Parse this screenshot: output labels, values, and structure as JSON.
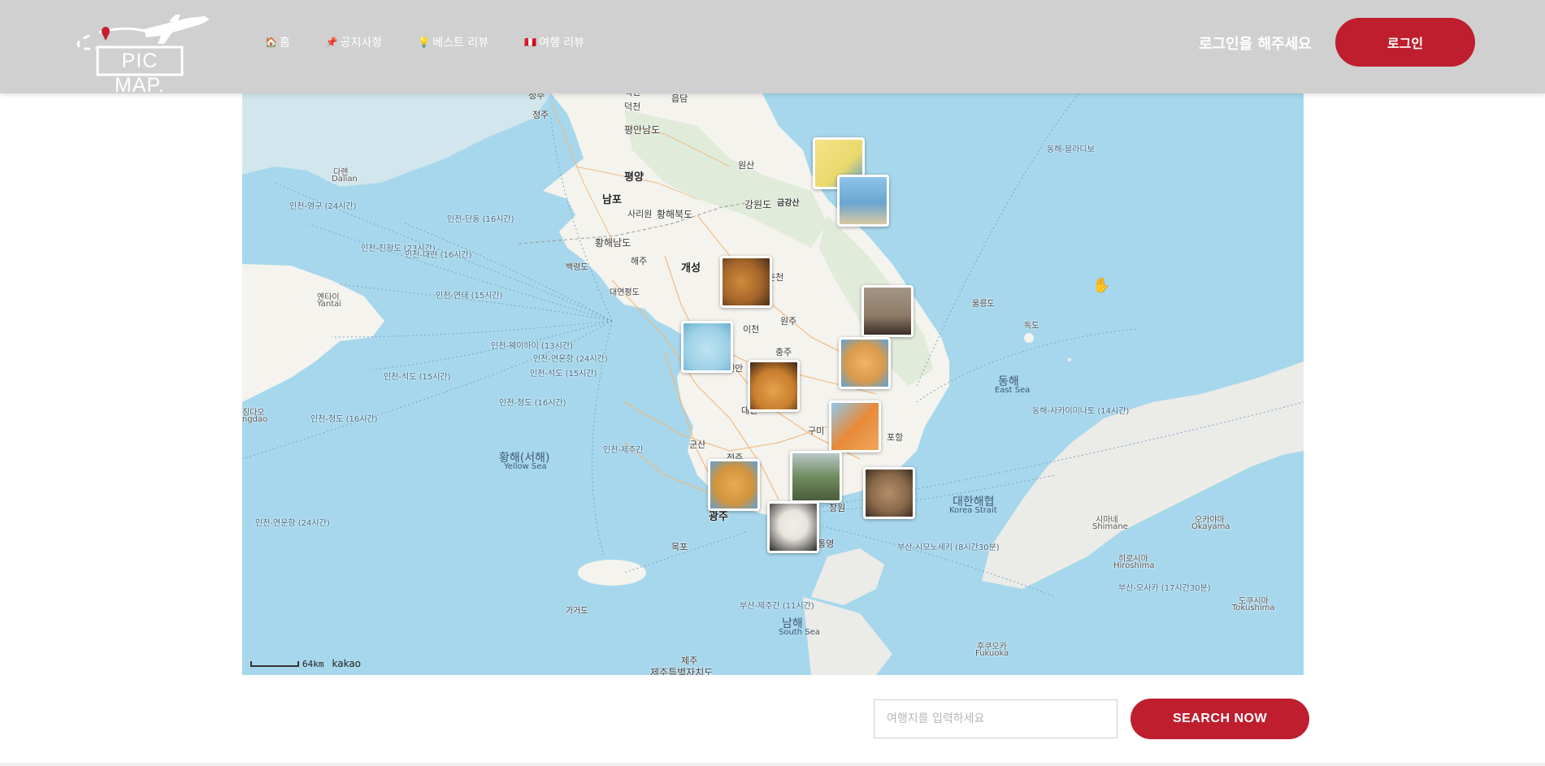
{
  "header": {
    "logo_text": "PIC MAP.",
    "nav": [
      {
        "icon": "🏠",
        "label": "홈"
      },
      {
        "icon": "📌",
        "label": "공지사항"
      },
      {
        "icon": "💡",
        "label": "베스트 리뷰"
      },
      {
        "icon": "🇵🇪",
        "label": "여행 리뷰"
      }
    ],
    "login_message": "로그인을 해주세요",
    "login_button": "로그인"
  },
  "colors": {
    "header_bg": "#cfd0cf",
    "accent": "#bf1e2e",
    "sea": "#a7d7ec",
    "land": "#f4f3ee"
  },
  "map": {
    "provider": "kakao",
    "scale_label": "64km",
    "places": {
      "pyongyang": "평양",
      "nampo": "남포",
      "sariwon": "사리원",
      "haeju": "해주",
      "kaesong": "개성",
      "wonsan": "원산",
      "jeongju": "정주",
      "deokcheon": "덕천",
      "pyeongannamdo": "평안남도",
      "hwanghaebukdo": "황해북도",
      "hwanghaenamdo": "황해남도",
      "gangwondo": "강원도",
      "geumgangsan": "금강산",
      "chuncheon": "춘천",
      "wonju": "원주",
      "icheon": "이천",
      "chungju": "충주",
      "cheonan": "천안",
      "daejeon": "대전",
      "gumi": "구미",
      "pohang": "포항",
      "gunsan": "군산",
      "jeonju": "전주",
      "gwangju": "광주",
      "mokpo": "목포",
      "changwon": "창원",
      "tongyeong": "통영",
      "jeju": "제주",
      "jejudo": "제주특별자치도",
      "ulleungdo": "울릉도",
      "dokdo": "독도",
      "baengnyeongdo": "백령도",
      "yeonpyeongdo": "대연평도",
      "gageodo": "가거도",
      "dalian": "다롄",
      "dalian_en": "Dalian",
      "yantai": "옌타이",
      "yantai_en": "Yantai",
      "qingdao": "칭다오",
      "qingdao_en": "ngdao",
      "eupdam": "읍담"
    },
    "seas": {
      "yellow_sea": "황해(서해)",
      "yellow_sea_en": "Yellow Sea",
      "east_sea": "동해",
      "east_sea_en": "East Sea",
      "korea_strait": "대한해협",
      "korea_strait_en": "Korea Strait",
      "south_sea": "남해",
      "south_sea_en": "South Sea"
    },
    "japan": {
      "shimane": "시마네",
      "shimane_en": "Shimane",
      "okayama": "오카야마",
      "okayama_en": "Okayama",
      "hiroshima": "히로시마",
      "hiroshima_en": "Hiroshima",
      "tokushima": "도쿠시마",
      "tokushima_en": "Tokushima",
      "fukuoka": "후쿠오카",
      "fukuoka_en": "Fukuoka"
    },
    "routes": {
      "r1": "인천-웨이하이 (13시간)",
      "r2": "인천-연운항 (24시간)",
      "r3": "인천-석도 (15시간)",
      "r4": "인천-석도 (15시간)",
      "r5": "인천-청도 (16시간)",
      "r6": "인천-청도 (16시간)",
      "r7": "인천-영구 (24시간)",
      "r8": "인천-진황도 (23시간)",
      "r9": "인천-대련 (16시간)",
      "r10": "인천-연태 (15시간)",
      "r11": "인천-단동 (16시간)",
      "r12": "인천-연운항 (24시간)",
      "r13": "인천-제주간",
      "r14": "부산-제주간 (11시간)",
      "r15": "부산-시모노세키 (8시간30분)",
      "r16": "부산-오사카 (17시간30분)",
      "r17": "동해-사카이미나토 (14시간)",
      "r18": "동해-블라디보"
    },
    "photo_markers": [
      {
        "name": "yellow-cartoon-character",
        "color": "#e9d96b"
      },
      {
        "name": "beach",
        "color": "#7fb2d6"
      },
      {
        "name": "fried-chicken",
        "color": "#a5652a"
      },
      {
        "name": "man-portrait",
        "color": "#8d7a66"
      },
      {
        "name": "blue-character",
        "color": "#9dd1e6"
      },
      {
        "name": "pomeranian-dog",
        "color": "#d89a4c"
      },
      {
        "name": "dessert",
        "color": "#c77d2d"
      },
      {
        "name": "orange-dragon-character",
        "color": "#e88a3a"
      },
      {
        "name": "mountain-village",
        "color": "#6f8c5e"
      },
      {
        "name": "angry-cartoon-face",
        "color": "#d2943c"
      },
      {
        "name": "monkey",
        "color": "#8a6a4b"
      },
      {
        "name": "panda",
        "color": "#e8e4dc"
      }
    ]
  },
  "search": {
    "placeholder": "여행지를 입력하세요",
    "button": "SEARCH NOW"
  }
}
